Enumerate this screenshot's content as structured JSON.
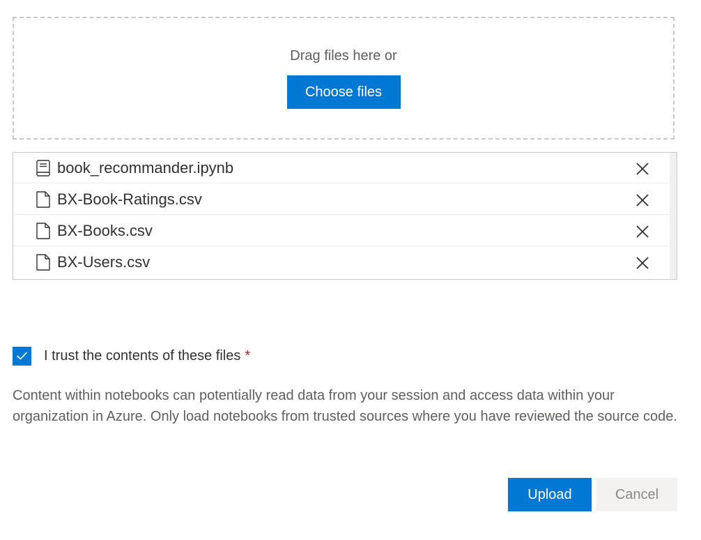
{
  "dropzone": {
    "prompt": "Drag files here or",
    "choose_label": "Choose files"
  },
  "files": [
    {
      "name": "book_recommander.ipynb",
      "icon": "notebook-icon"
    },
    {
      "name": "BX-Book-Ratings.csv",
      "icon": "file-icon"
    },
    {
      "name": "BX-Books.csv",
      "icon": "file-icon"
    },
    {
      "name": "BX-Users.csv",
      "icon": "file-icon"
    }
  ],
  "trust": {
    "checked": true,
    "label": "I trust the contents of these files",
    "required_marker": "*"
  },
  "warning": "Content within notebooks can potentially read data from your session and access data within your organization in Azure. Only load notebooks from trusted sources where you have reviewed the source code.",
  "actions": {
    "upload_label": "Upload",
    "cancel_label": "Cancel"
  },
  "colors": {
    "accent": "#0078d4",
    "required": "#a4262c"
  }
}
